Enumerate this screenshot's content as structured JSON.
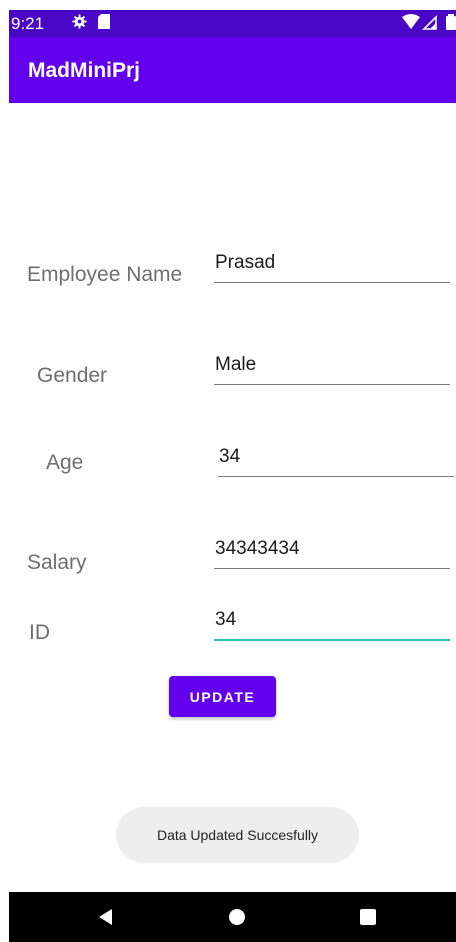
{
  "status_bar": {
    "time": "9:21",
    "icons": [
      "gear-icon",
      "sd-card-icon",
      "wifi-icon",
      "signal-icon",
      "battery-icon"
    ]
  },
  "app_bar": {
    "title": "MadMiniPrj"
  },
  "form": {
    "employee_name": {
      "label": "Employee Name",
      "value": "Prasad"
    },
    "gender": {
      "label": "Gender",
      "value": "Male"
    },
    "age": {
      "label": "Age",
      "value": "34"
    },
    "salary": {
      "label": "Salary",
      "value": "34343434"
    },
    "id": {
      "label": "ID",
      "value": "34"
    }
  },
  "update_button": {
    "label": "UPDATE"
  },
  "toast": {
    "message": "Data Updated Succesfully"
  },
  "nav_bar": {
    "icons": [
      "back-icon",
      "home-icon",
      "recents-icon"
    ]
  },
  "colors": {
    "primary": "#6200ee",
    "primary_dark": "#4a06c7",
    "focus_underline": "#26c6b5",
    "label_gray": "#6f6f6f"
  }
}
